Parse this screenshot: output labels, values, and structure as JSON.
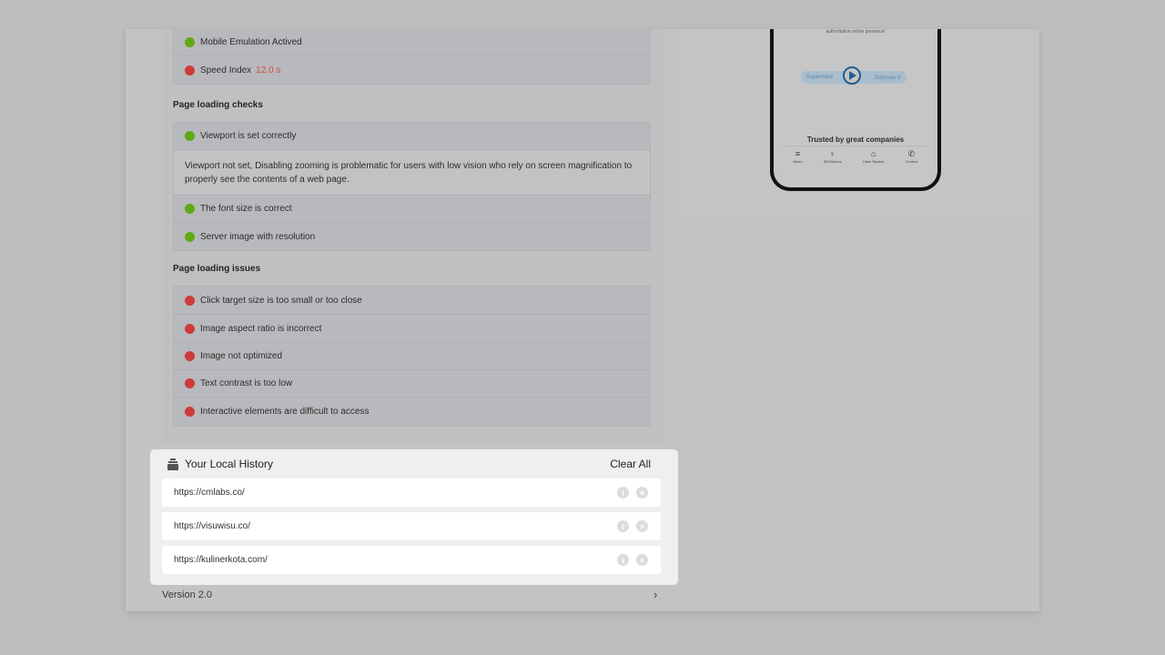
{
  "checks_top": [
    {
      "status": "green",
      "label": "Mobile Emulation Actived"
    },
    {
      "status": "red",
      "label": "Speed Index",
      "value": "12.0 s"
    }
  ],
  "loading_checks": {
    "title": "Page loading checks",
    "viewport": {
      "status": "green",
      "label": "Viewport is set correctly"
    },
    "description": "Viewport not set, Disabling zooming is problematic for users with low vision who rely on screen magnification to properly see the contents of a web page.",
    "items": [
      {
        "status": "green",
        "label": "The font size is correct"
      },
      {
        "status": "green",
        "label": "Server image with resolution"
      }
    ]
  },
  "loading_issues": {
    "title": "Page loading issues",
    "items": [
      {
        "status": "red",
        "label": "Click target size is too small or too close"
      },
      {
        "status": "red",
        "label": "Image aspect ratio is incorrect"
      },
      {
        "status": "red",
        "label": "Image not optimized"
      },
      {
        "status": "red",
        "label": "Text contrast is too low"
      },
      {
        "status": "red",
        "label": "Interactive elements are difficult to access"
      }
    ]
  },
  "phone_preview": {
    "tagline": "authoritative online presence!",
    "search_left": "Supernova",
    "search_right": "Odyssey",
    "trusted": "Trusted by great companies",
    "nav": [
      {
        "icon": "menu-icon",
        "glyph": "≡",
        "label": "Menu"
      },
      {
        "icon": "bulb-icon",
        "glyph": "♀",
        "label": "SEOlutions"
      },
      {
        "icon": "chart-icon",
        "glyph": "⌂",
        "label": "Case Studies"
      },
      {
        "icon": "chat-icon",
        "glyph": "✆",
        "label": "Contact"
      }
    ]
  },
  "history": {
    "title": "Your Local History",
    "clear_all": "Clear All",
    "rows": [
      {
        "url": "https://cmlabs.co/"
      },
      {
        "url": "https://visuwisu.co/"
      },
      {
        "url": "https://kulinerkota.com/"
      }
    ]
  },
  "footer": {
    "version": "Version 2.0",
    "chevron": "›"
  },
  "colors": {
    "green": "#5faa14",
    "red": "#cf3a3a",
    "background": "#bdbdbe"
  }
}
